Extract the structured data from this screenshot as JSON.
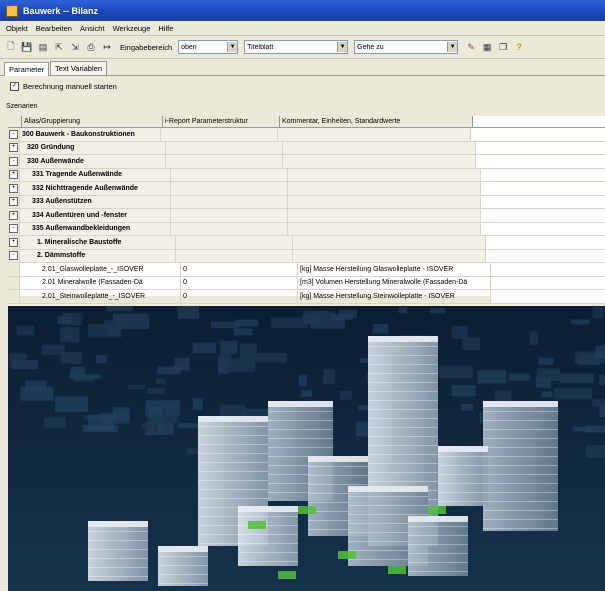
{
  "window": {
    "title": "Bauwerk -- Bilanz"
  },
  "menu": [
    "Objekt",
    "Bearbeiten",
    "Ansicht",
    "Werkzeuge",
    "Hilfe"
  ],
  "toolbar": {
    "eingabebereich_label": "Eingabebereich",
    "eingabebereich_value": "oben",
    "titelblatt_value": "Titelblatt",
    "gehezu_value": "Gehe zu"
  },
  "tabs": [
    "Parameter",
    "Text Variablen"
  ],
  "options": {
    "berechnung_label": "Berechnung manuell starten",
    "berechnung_checked": true
  },
  "scenarios_label": "Szenarien",
  "grid": {
    "columns": [
      "Alias/Gruppierung",
      "i-Report Parameterstruktur",
      "Kommentar, Einheiten, Standardwerte"
    ],
    "rows": [
      {
        "exp": "-",
        "alias": "300 Bauwerk - Baukonstruktionen",
        "param": "",
        "comment": "",
        "bold": true,
        "indent": 0
      },
      {
        "exp": "+",
        "alias": "320 Gründung",
        "param": "",
        "comment": "",
        "bold": true,
        "indent": 1
      },
      {
        "exp": "-",
        "alias": "330 Außenwände",
        "param": "",
        "comment": "",
        "bold": true,
        "indent": 1
      },
      {
        "exp": "+",
        "alias": "331 Tragende Außenwände",
        "param": "",
        "comment": "",
        "bold": true,
        "indent": 2
      },
      {
        "exp": "+",
        "alias": "332 Nichttragende Außenwände",
        "param": "",
        "comment": "",
        "bold": true,
        "indent": 2
      },
      {
        "exp": "+",
        "alias": "333 Außenstützen",
        "param": "",
        "comment": "",
        "bold": true,
        "indent": 2
      },
      {
        "exp": "+",
        "alias": "334 Außentüren und -fenster",
        "param": "",
        "comment": "",
        "bold": true,
        "indent": 2
      },
      {
        "exp": "-",
        "alias": "335 Außenwandbekleidungen",
        "param": "",
        "comment": "",
        "bold": true,
        "indent": 2
      },
      {
        "exp": "+",
        "alias": "1. Mineralische Baustoffe",
        "param": "",
        "comment": "",
        "bold": true,
        "indent": 3
      },
      {
        "exp": "-",
        "alias": "2. Dämmstoffe",
        "param": "",
        "comment": "",
        "bold": true,
        "indent": 3
      },
      {
        "exp": "",
        "alias": "2.01_Glaswolleplatte_-_ISOVER",
        "param": "0",
        "comment": "[kg] Masse Herstellung Glaswolleplatte - ISOVER",
        "bold": false,
        "indent": 4
      },
      {
        "exp": "",
        "alias": "2.01 Mineralwolle (Fassaden-Dä",
        "param": "0",
        "comment": "[m3] Volumen Herstellung Mineralwolle (Fassaden-Dä",
        "bold": false,
        "indent": 4
      },
      {
        "exp": "",
        "alias": "2.01_Steinwolleplatte_-_ISOVER",
        "param": "0",
        "comment": "[kg] Masse Herstellung Steinwolleplatte - ISOVER",
        "bold": false,
        "indent": 4
      }
    ]
  },
  "image": {
    "subject": "city-model-render"
  }
}
